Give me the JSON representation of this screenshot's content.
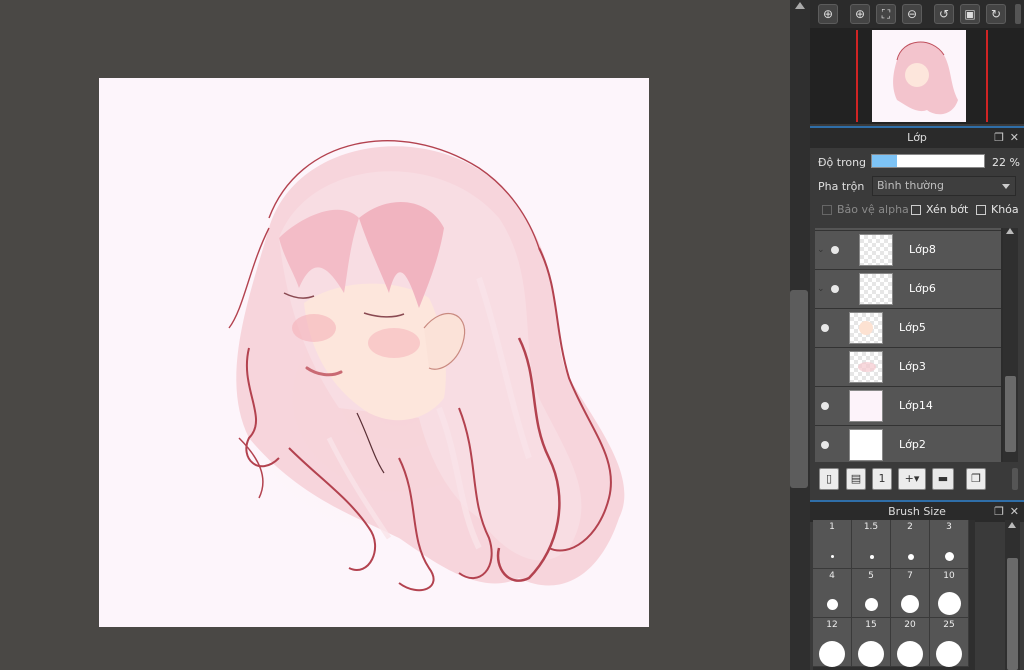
{
  "navigator": {
    "tools": [
      "zoom-in-icon",
      "zoom-in-icon",
      "fit-icon",
      "zoom-out-icon",
      "rotate-left-icon",
      "fullscreen-icon",
      "rotate-right-icon"
    ]
  },
  "layer_panel": {
    "title": "Lớp",
    "opacity_label": "Độ trong",
    "opacity_value": "22 %",
    "opacity_fraction": 0.22,
    "blend_label": "Pha trộn",
    "blend_value": "Bình thường",
    "protect_alpha": "Bảo vệ alpha",
    "clipping": "Xén bớt",
    "lock": "Khóa",
    "layers": [
      {
        "name": "Lớp8",
        "visible": true,
        "in_folder": true
      },
      {
        "name": "Lớp6",
        "visible": true,
        "in_folder": true
      },
      {
        "name": "Lớp5",
        "visible": true,
        "in_folder": false
      },
      {
        "name": "Lớp3",
        "visible": false,
        "in_folder": false
      },
      {
        "name": "Lớp14",
        "visible": true,
        "in_folder": false
      },
      {
        "name": "Lớp2",
        "visible": true,
        "in_folder": false
      }
    ]
  },
  "brush_panel": {
    "title": "Brush Size",
    "sizes": [
      "1",
      "1.5",
      "2",
      "3",
      "4",
      "5",
      "7",
      "10",
      "12",
      "15",
      "20",
      "25"
    ]
  },
  "colors": {
    "accent": "#2f6ea8",
    "canvas_bg": "#fdf5fb",
    "hair": "#f4c2cc",
    "line": "#b3424f"
  }
}
